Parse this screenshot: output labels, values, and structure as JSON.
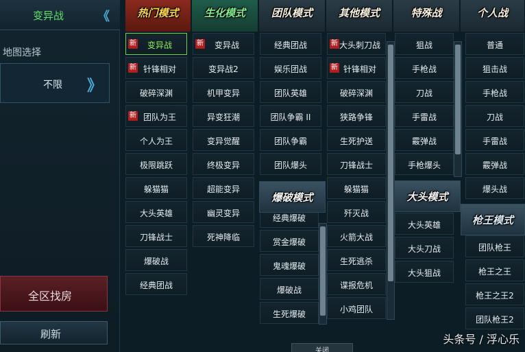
{
  "left_panel": {
    "mode_title": "变异战",
    "mode_arrow": "《",
    "map_label": "地图选择",
    "map_value": "不限",
    "map_arrow": "》",
    "search_button": "全区找房",
    "refresh_button": "刷新"
  },
  "tabs": [
    {
      "label": "热门模式"
    },
    {
      "label": "生化模式"
    },
    {
      "label": "团队模式"
    },
    {
      "label": "其他模式"
    },
    {
      "label": "特殊战"
    },
    {
      "label": "个人战"
    }
  ],
  "columns": {
    "hot": [
      {
        "label": "变异战",
        "badge": "新",
        "selected": true
      },
      {
        "label": "针锋相对",
        "badge": "新"
      },
      {
        "label": "破碎深渊"
      },
      {
        "label": "团队为王",
        "badge": "新"
      },
      {
        "label": "个人为王"
      },
      {
        "label": "极限跳跃"
      },
      {
        "label": "躲猫猫"
      },
      {
        "label": "大头英雄"
      },
      {
        "label": "刀锋战士"
      },
      {
        "label": "爆破战"
      },
      {
        "label": "经典团战"
      }
    ],
    "bio": [
      {
        "label": "变异战",
        "badge": "新"
      },
      {
        "label": "变异战2"
      },
      {
        "label": "机甲变异"
      },
      {
        "label": "异变狂潮"
      },
      {
        "label": "变异觉醒"
      },
      {
        "label": "终极变异"
      },
      {
        "label": "超能变异"
      },
      {
        "label": "幽灵变异"
      },
      {
        "label": "死神降临"
      }
    ],
    "team": [
      {
        "label": "经典团战"
      },
      {
        "label": "娱乐团战"
      },
      {
        "label": "团队英雄"
      },
      {
        "label": "团队争霸 II"
      },
      {
        "label": "团队争霸"
      },
      {
        "label": "团队爆头"
      }
    ],
    "demolition_header": "爆破模式",
    "demolition": [
      {
        "label": "经典爆破"
      },
      {
        "label": "赏金爆破"
      },
      {
        "label": "鬼魂爆破"
      },
      {
        "label": "爆破战"
      },
      {
        "label": "生死爆破"
      }
    ],
    "other": [
      {
        "label": "大头刺刀战",
        "badge": "新"
      },
      {
        "label": "针锋相对",
        "badge": "新"
      },
      {
        "label": "破碎深渊"
      },
      {
        "label": "狭路争锋"
      },
      {
        "label": "生死护送"
      },
      {
        "label": "刀锋战士"
      },
      {
        "label": "躲猫猫"
      },
      {
        "label": "歼灭战"
      },
      {
        "label": "火箭大战"
      },
      {
        "label": "生死逃杀"
      },
      {
        "label": "谍报危机"
      },
      {
        "label": "小鸡团队"
      }
    ],
    "special": [
      {
        "label": "狙战"
      },
      {
        "label": "手枪战"
      },
      {
        "label": "刀战"
      },
      {
        "label": "手雷战"
      },
      {
        "label": "霰弹战"
      },
      {
        "label": "手枪爆头"
      }
    ],
    "bighead_header": "大头模式",
    "bighead": [
      {
        "label": "大头英雄"
      },
      {
        "label": "大头刀战"
      },
      {
        "label": "大头狙战"
      }
    ],
    "personal": [
      {
        "label": "普通"
      },
      {
        "label": "狙击战"
      },
      {
        "label": "手枪战"
      },
      {
        "label": "刀战"
      },
      {
        "label": "手雷战"
      },
      {
        "label": "霰弹战"
      },
      {
        "label": "爆头战"
      }
    ],
    "king_header": "枪王模式",
    "king": [
      {
        "label": "团队枪王"
      },
      {
        "label": "枪王之王"
      },
      {
        "label": "枪王之王2"
      },
      {
        "label": "团队枪王2"
      }
    ]
  },
  "close_button": "关闭",
  "watermark": "头条号 / 浮心乐"
}
